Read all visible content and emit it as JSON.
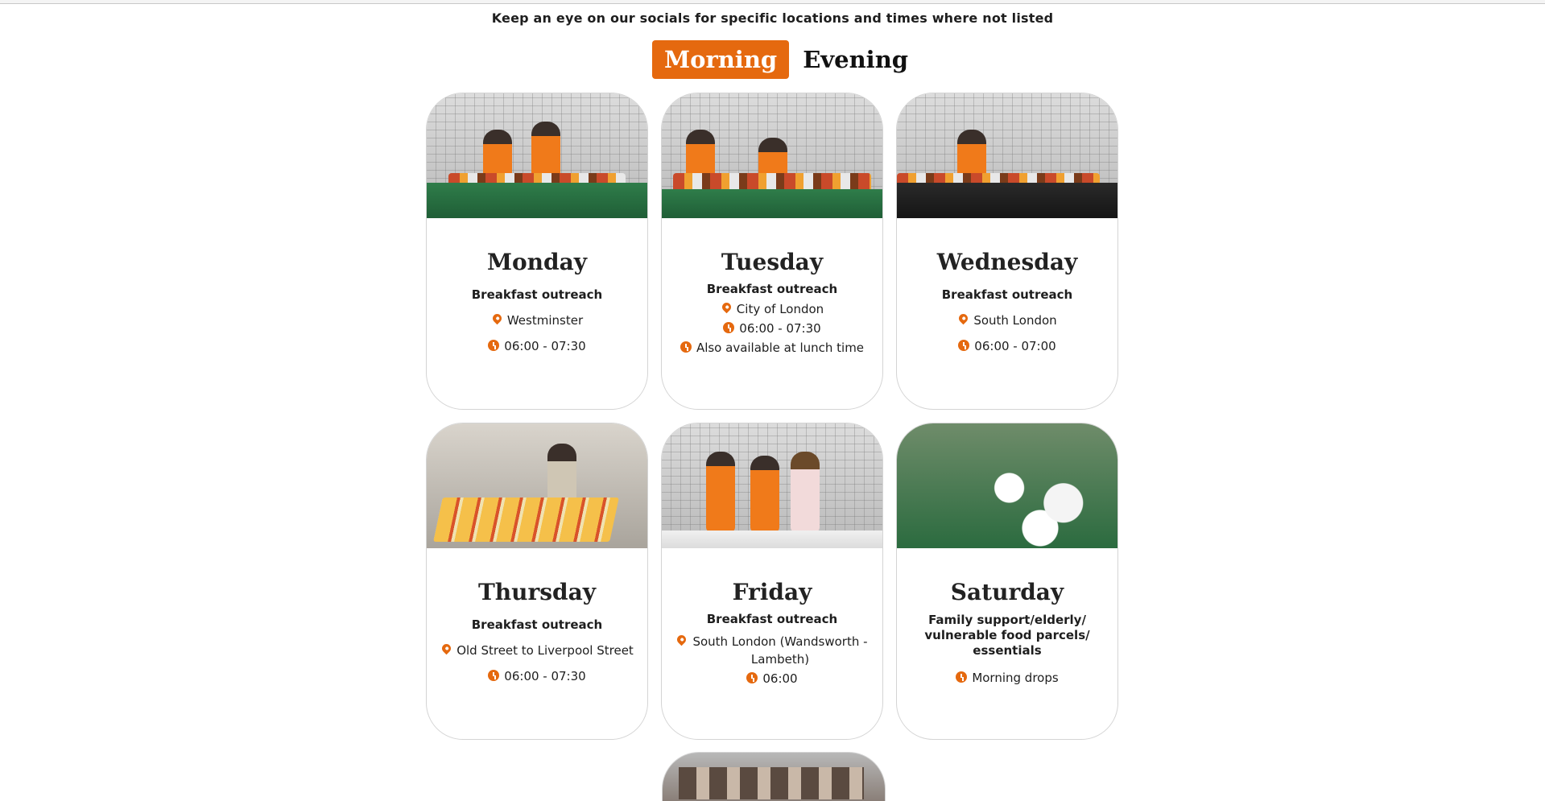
{
  "notice": "Keep an eye on our socials for specific locations and times where not listed",
  "tabs": [
    {
      "label": "Morning",
      "active": true
    },
    {
      "label": "Evening",
      "active": false
    }
  ],
  "accent_color": "#e5690f",
  "cards": [
    {
      "day": "Monday",
      "subtitle": "Breakfast outreach",
      "rows": [
        {
          "icon": "location-pin-icon",
          "text": "Westminster"
        },
        {
          "icon": "clock-icon",
          "text": "06:00 - 07:30"
        }
      ]
    },
    {
      "day": "Tuesday",
      "subtitle": "Breakfast outreach",
      "rows": [
        {
          "icon": "location-pin-icon",
          "text": "City of London"
        },
        {
          "icon": "clock-icon",
          "text": "06:00 - 07:30"
        },
        {
          "icon": "clock-icon",
          "text": "Also available at lunch time"
        }
      ]
    },
    {
      "day": "Wednesday",
      "subtitle": "Breakfast outreach",
      "rows": [
        {
          "icon": "location-pin-icon",
          "text": "South London"
        },
        {
          "icon": "clock-icon",
          "text": "06:00 - 07:00"
        }
      ]
    },
    {
      "day": "Thursday",
      "subtitle": "Breakfast outreach",
      "rows": [
        {
          "icon": "location-pin-icon",
          "text": "Old Street to Liverpool Street"
        },
        {
          "icon": "clock-icon",
          "text": "06:00 - 07:30"
        }
      ]
    },
    {
      "day": "Friday",
      "subtitle": "Breakfast outreach",
      "rows": [
        {
          "icon": "location-pin-icon",
          "text": "South London (Wandsworth - Lambeth)"
        },
        {
          "icon": "clock-icon",
          "text": "06:00"
        }
      ]
    },
    {
      "day": "Saturday",
      "subtitle": "Family support/elderly/ vulnerable food parcels/ essentials",
      "rows": [
        {
          "icon": "clock-icon",
          "text": "Morning drops"
        }
      ]
    }
  ]
}
